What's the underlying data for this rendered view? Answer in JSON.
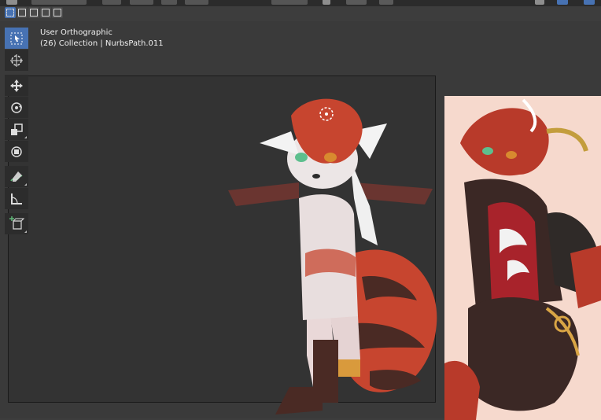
{
  "viewport": {
    "view_name": "User Orthographic",
    "object_info": "(26) Collection | NurbsPath.011"
  },
  "colors": {
    "viewport_bg": "#3a3a3a",
    "camera_frame_bg": "#333333",
    "active_tool": "#4772b3",
    "toolbar_bg": "#2c2c2c",
    "reference_bg": "#f6d9cd",
    "fur_red": "#c7452f",
    "fur_dark": "#4a2a24"
  },
  "toolbar": {
    "tools": [
      {
        "name": "select-box-tool",
        "icon": "select-box-icon",
        "active": true
      },
      {
        "name": "cursor-tool",
        "icon": "cursor-icon",
        "active": false
      },
      {
        "name": "move-tool",
        "icon": "move-icon",
        "active": false
      },
      {
        "name": "rotate-tool",
        "icon": "rotate-icon",
        "active": false
      },
      {
        "name": "scale-tool",
        "icon": "scale-icon",
        "active": false
      },
      {
        "name": "transform-tool",
        "icon": "transform-icon",
        "active": false
      },
      {
        "name": "annotate-tool",
        "icon": "annotate-icon",
        "active": false
      },
      {
        "name": "measure-tool",
        "icon": "measure-icon",
        "active": false
      },
      {
        "name": "add-cube-tool",
        "icon": "add-cube-icon",
        "active": false
      }
    ]
  },
  "selection_modes": [
    "new-selection-icon",
    "extend-selection-icon",
    "subtract-selection-icon",
    "invert-selection-icon",
    "intersect-selection-icon"
  ]
}
